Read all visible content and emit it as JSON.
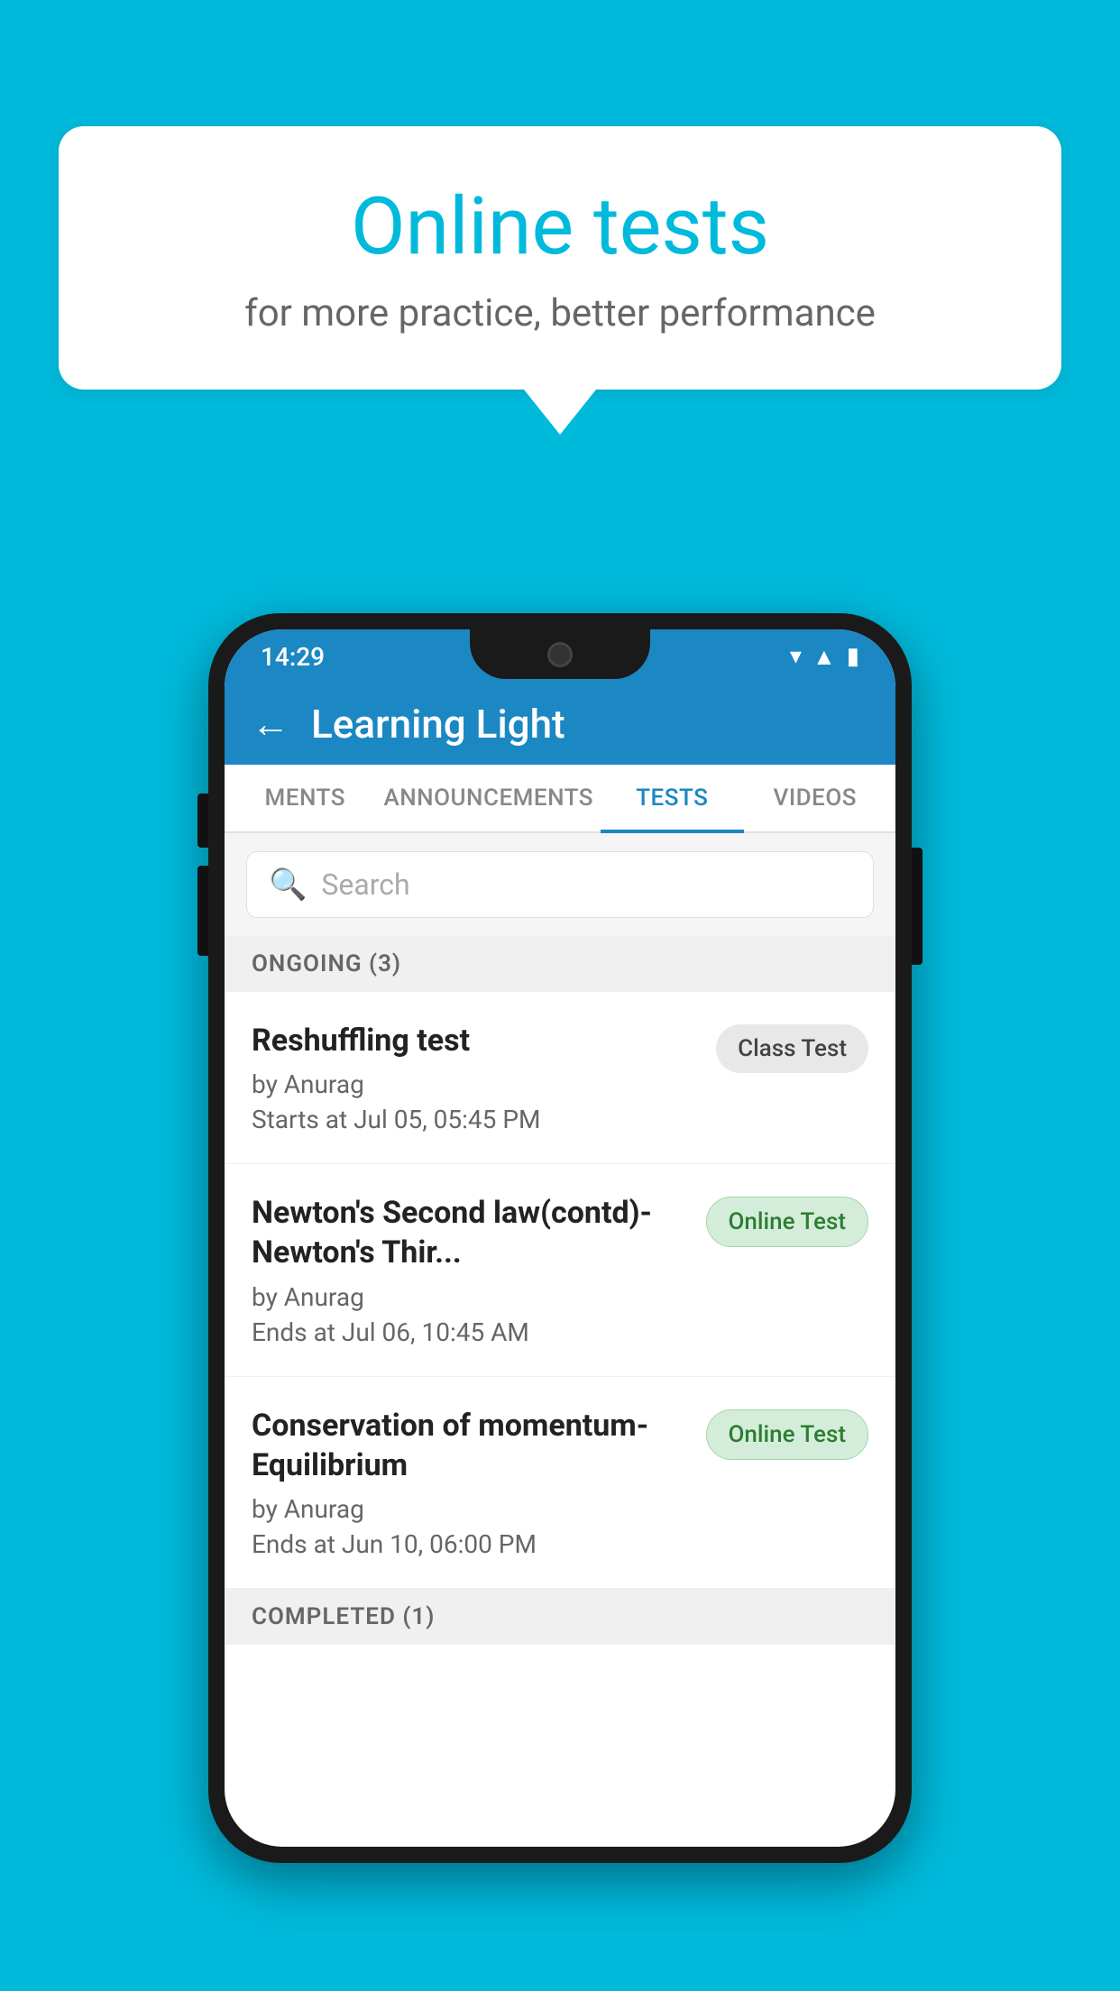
{
  "background": {
    "color": "#00BADC"
  },
  "bubble": {
    "title": "Online tests",
    "subtitle": "for more practice, better performance"
  },
  "phone": {
    "statusBar": {
      "time": "14:29",
      "icons": [
        "wifi",
        "signal",
        "battery"
      ]
    },
    "appBar": {
      "title": "Learning Light",
      "backLabel": "←"
    },
    "tabs": [
      {
        "label": "MENTS",
        "active": false
      },
      {
        "label": "ANNOUNCEMENTS",
        "active": false
      },
      {
        "label": "TESTS",
        "active": true
      },
      {
        "label": "VIDEOS",
        "active": false
      }
    ],
    "search": {
      "placeholder": "Search"
    },
    "ongoingSection": {
      "label": "ONGOING (3)"
    },
    "tests": [
      {
        "title": "Reshuffling test",
        "by": "by Anurag",
        "time": "Starts at  Jul 05, 05:45 PM",
        "badge": "Class Test",
        "badgeType": "class"
      },
      {
        "title": "Newton's Second law(contd)-Newton's Thir...",
        "by": "by Anurag",
        "time": "Ends at  Jul 06, 10:45 AM",
        "badge": "Online Test",
        "badgeType": "online"
      },
      {
        "title": "Conservation of momentum-Equilibrium",
        "by": "by Anurag",
        "time": "Ends at  Jun 10, 06:00 PM",
        "badge": "Online Test",
        "badgeType": "online"
      }
    ],
    "completedSection": {
      "label": "COMPLETED (1)"
    }
  }
}
